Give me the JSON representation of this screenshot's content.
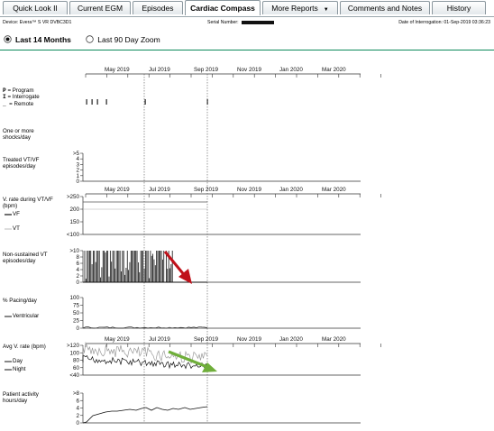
{
  "tabs": [
    {
      "label": "Quick Look II",
      "active": false
    },
    {
      "label": "Current EGM",
      "active": false
    },
    {
      "label": "Episodes",
      "active": false
    },
    {
      "label": "Cardiac Compass",
      "active": true
    },
    {
      "label": "More Reports",
      "active": false,
      "dropdown": true
    },
    {
      "label": "Comments and Notes",
      "active": false
    },
    {
      "label": "History",
      "active": false
    }
  ],
  "device_info": {
    "device": "Device: Evera™ S VR DVBC3D1",
    "serial_label": "Serial Number:",
    "interrogation": "Date of Interrogation: 01-Sep-2019 03:36:23"
  },
  "view_options": {
    "last_14_months": "Last 14 Months",
    "last_90_day_zoom": "Last 90 Day Zoom",
    "selected": "last_14_months"
  },
  "x_axis": {
    "months": [
      "May 2019",
      "Jul 2019",
      "Sep 2019",
      "Nov 2019",
      "Jan 2020",
      "Mar 2020"
    ]
  },
  "legend": {
    "program": "= Program",
    "interrogate": "= Interrogate",
    "remote": "= Remote",
    "program_glyph": "P",
    "interrogate_glyph": "I",
    "remote_glyph": "_"
  },
  "event_markers": {
    "glyphs": [
      "I",
      "I",
      "I",
      "I",
      "I",
      "I"
    ]
  },
  "panels": {
    "shocks": {
      "label": "One or more\nshocks/day"
    },
    "treated_vt_vf": {
      "label": "Treated VT/VF\nepisodes/day",
      "ticks": [
        ">5",
        "4",
        "3",
        "2",
        "1",
        "0"
      ]
    },
    "vrate": {
      "label": "V. rate during VT/VF\n(bpm)",
      "vf": "VF",
      "vt": "VT",
      "ticks": [
        ">250",
        "200",
        "150",
        "<100"
      ]
    },
    "nsvt": {
      "label": "Non-sustained VT\nepisodes/day",
      "ticks": [
        ">10",
        "8",
        "6",
        "4",
        "2",
        "0"
      ]
    },
    "pacing": {
      "label": "% Pacing/day",
      "ventricular": "Ventricular",
      "ticks": [
        "100",
        "75",
        "50",
        "25",
        "0"
      ]
    },
    "avg_rate": {
      "label": "Avg V. rate (bpm)",
      "day": "Day",
      "night": "Night",
      "ticks": [
        ">120",
        "100",
        "80",
        "60",
        "<40"
      ]
    },
    "activity": {
      "label": "Patient activity\nhours/day",
      "ticks": [
        ">8",
        "6",
        "4",
        "2",
        "0"
      ]
    }
  },
  "colors": {
    "red_arrow": "#c0111a",
    "green_arrow": "#6fae3a",
    "header_rule": "#0b8a5a"
  }
}
